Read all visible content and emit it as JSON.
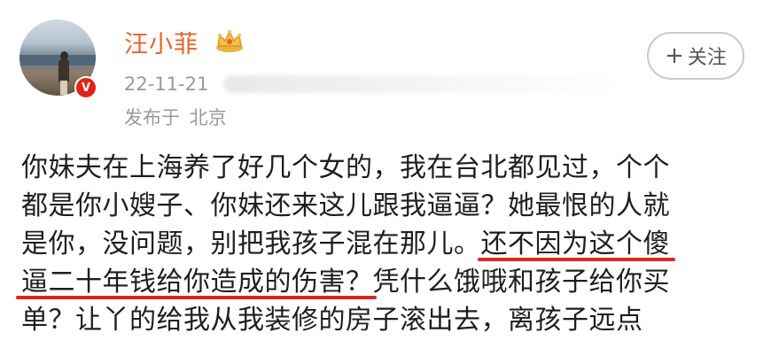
{
  "user": {
    "name": "汪小菲",
    "timestamp": "22-11-21",
    "location": "发布于 北京",
    "verified_badge": "V"
  },
  "follow_button": {
    "plus": "+",
    "label": "关注"
  },
  "post": {
    "lines": [
      "你妹夫在上海养了好几个女的，我在台北都见过，个个",
      "都是你小嫂子、你妹还来这儿跟我逼逼？她最恨的人就"
    ],
    "line3_plain": "是你，没问题，别把我孩子混在那儿。",
    "line3_highlight": "还不因为这个傻",
    "line4_highlight": "逼二十年钱给你造成的伤害？",
    "line4_plain": "凭什么饿哦和孩子给你买",
    "line5": "单？让丫的给我从我装修的房子滚出去，离孩子远点"
  },
  "colors": {
    "username": "#e8622a",
    "underline": "#d8281e",
    "badge": "#e2231a",
    "meta_text": "#9a9a9a"
  },
  "icons": [
    "crown-icon",
    "verified-v-icon",
    "plus-icon"
  ]
}
